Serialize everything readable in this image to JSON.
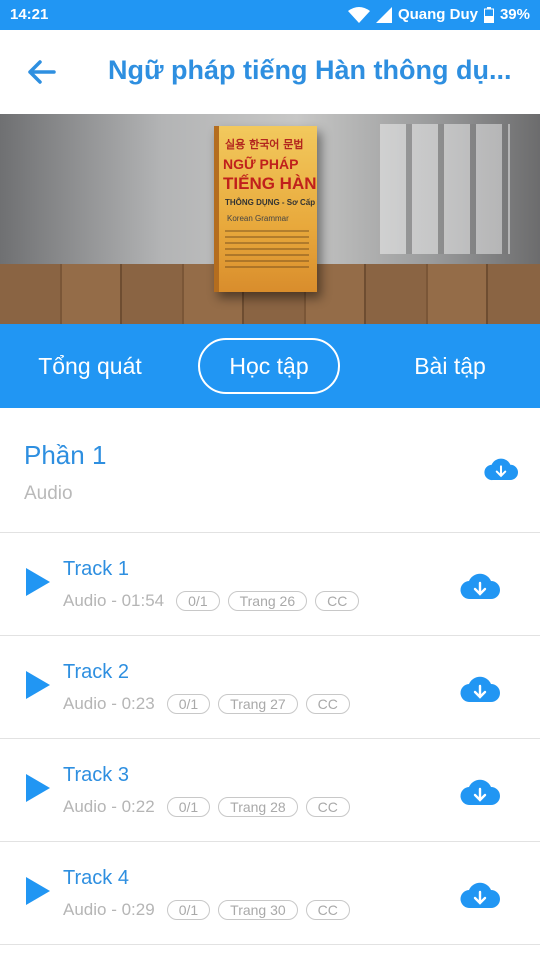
{
  "status_bar": {
    "time": "14:21",
    "carrier": "Quang Duy",
    "battery": "39%"
  },
  "app_bar": {
    "title": "Ngữ pháp tiếng Hàn thông dụ..."
  },
  "hero": {
    "book_korean": "실용 한국어 문법",
    "book_line1": "NGỮ PHÁP",
    "book_line2": "TIẾNG HÀN",
    "book_line3": "THÔNG DỤNG - Sơ Cấp",
    "book_line4": "Korean Grammar"
  },
  "tabs": [
    {
      "label": "Tổng quát"
    },
    {
      "label": "Học tập",
      "selected": true
    },
    {
      "label": "Bài tập"
    }
  ],
  "section": {
    "title": "Phần 1",
    "subtitle": "Audio"
  },
  "tracks": [
    {
      "title": "Track 1",
      "duration": "Audio - 01:54",
      "progress": "0/1",
      "page": "Trang 26",
      "cc": "CC"
    },
    {
      "title": "Track 2",
      "duration": "Audio - 0:23",
      "progress": "0/1",
      "page": "Trang 27",
      "cc": "CC"
    },
    {
      "title": "Track 3",
      "duration": "Audio - 0:22",
      "progress": "0/1",
      "page": "Trang 28",
      "cc": "CC"
    },
    {
      "title": "Track 4",
      "duration": "Audio - 0:29",
      "progress": "0/1",
      "page": "Trang 30",
      "cc": "CC"
    }
  ],
  "colors": {
    "primary": "#2196F3",
    "accent_text": "#2E8FE0",
    "muted": "#b5b5b5"
  },
  "icons": {
    "back": "arrow-left-icon",
    "play": "play-icon",
    "download": "cloud-download-icon"
  }
}
